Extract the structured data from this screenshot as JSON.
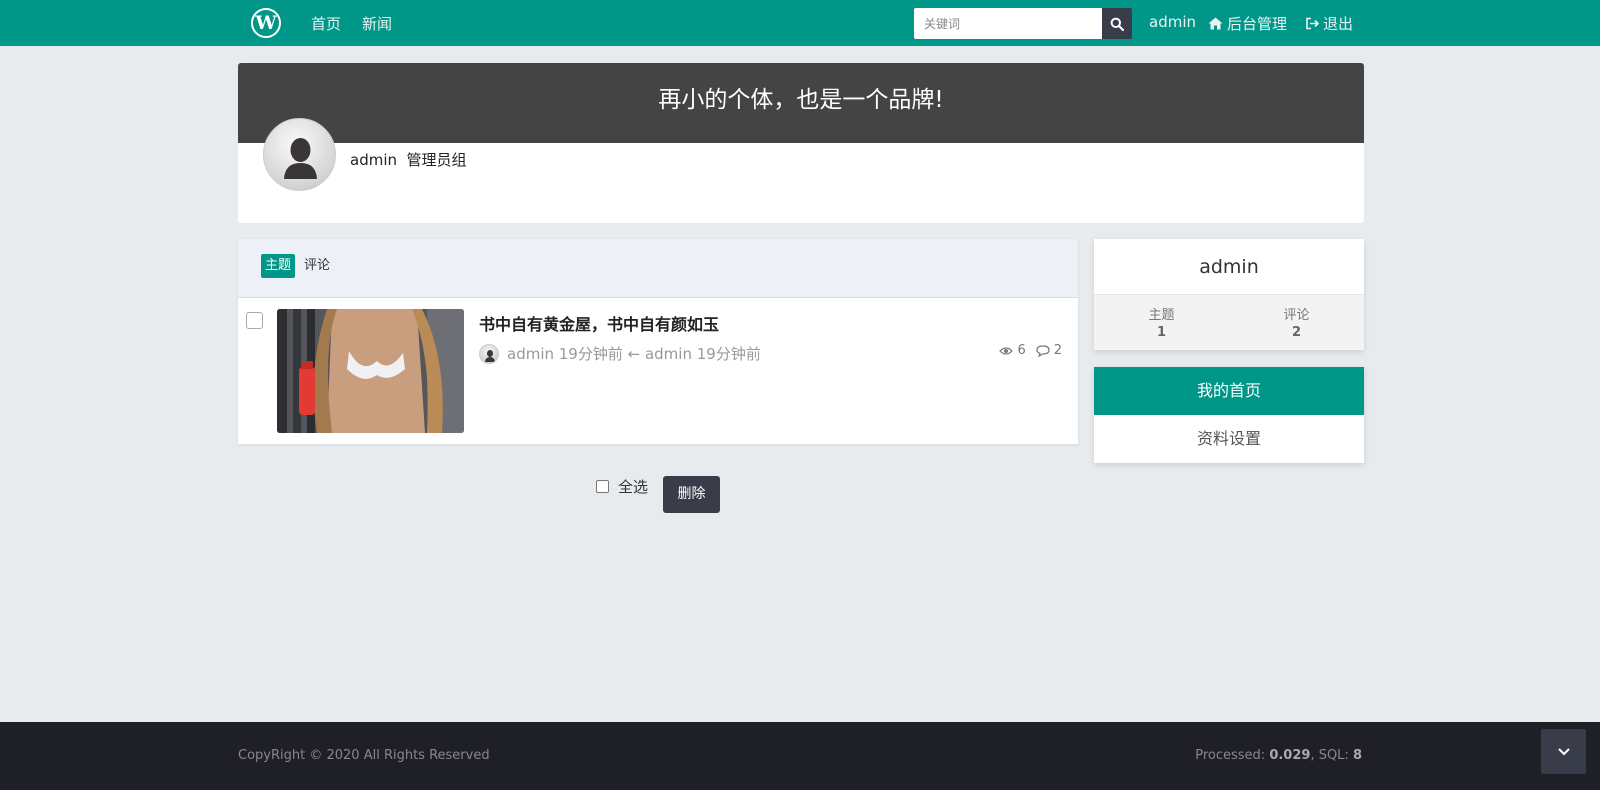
{
  "nav": {
    "logo_letter": "W",
    "links": [
      "首页",
      "新闻"
    ],
    "search_placeholder": "关键词",
    "user": "admin",
    "admin_label": "后台管理",
    "logout_label": "退出"
  },
  "profile": {
    "slogan": "再小的个体，也是一个品牌!",
    "name": "admin",
    "group": "管理员组"
  },
  "tabs": [
    "主题",
    "评论"
  ],
  "post": {
    "title": "书中自有黄金屋，书中自有颜如玉",
    "meta": "admin 19分钟前 ← admin 19分钟前",
    "views": "6",
    "comments": "2"
  },
  "bulk": {
    "select_all": "全选",
    "delete": "删除"
  },
  "sidebar": {
    "name": "admin",
    "stats": [
      {
        "label": "主题",
        "value": "1"
      },
      {
        "label": "评论",
        "value": "2"
      }
    ],
    "menu": [
      "我的首页",
      "资料设置"
    ]
  },
  "footer": {
    "copyright": "CopyRight © 2020 All Rights Reserved",
    "processed_label": "Processed:",
    "processed_value": "0.029",
    "sql_label": ", SQL:",
    "sql_value": "8"
  },
  "colors": {
    "accent": "#009688",
    "dark": "#393d49",
    "banner": "#444444",
    "footer": "#1f1f27"
  }
}
